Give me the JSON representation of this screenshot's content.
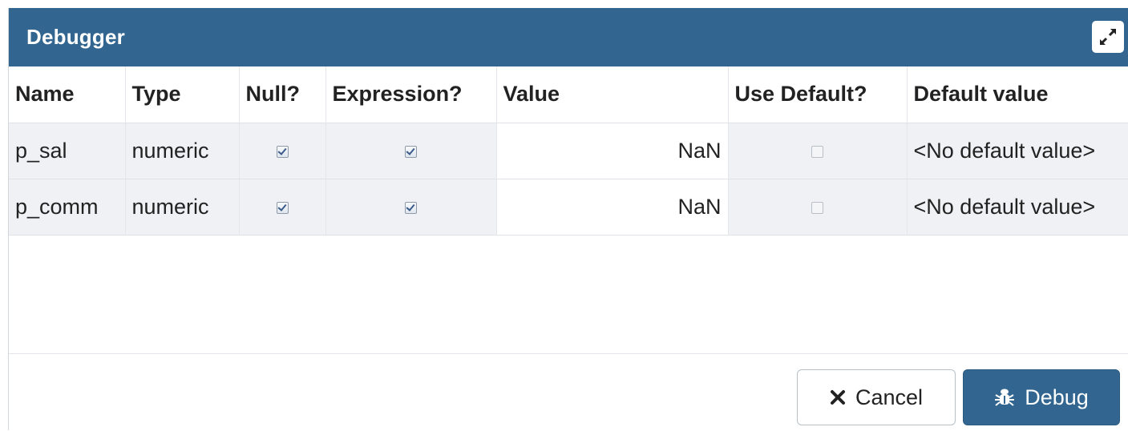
{
  "dialog": {
    "title": "Debugger"
  },
  "table": {
    "columns": [
      "Name",
      "Type",
      "Null?",
      "Expression?",
      "Value",
      "Use Default?",
      "Default value"
    ],
    "rows": [
      {
        "name": "p_sal",
        "type": "numeric",
        "null": true,
        "expression": true,
        "value": "NaN",
        "use_default": false,
        "default_value": "<No default value>"
      },
      {
        "name": "p_comm",
        "type": "numeric",
        "null": true,
        "expression": true,
        "value": "NaN",
        "use_default": false,
        "default_value": "<No default value>"
      }
    ]
  },
  "footer": {
    "cancel_label": "Cancel",
    "debug_label": "Debug"
  },
  "icons": {
    "maximize": "maximize-icon",
    "cancel": "close-icon",
    "debug": "bug-icon"
  },
  "colors": {
    "header": "#326690",
    "primary_button": "#326690",
    "readonly_cell": "#eff1f5"
  }
}
